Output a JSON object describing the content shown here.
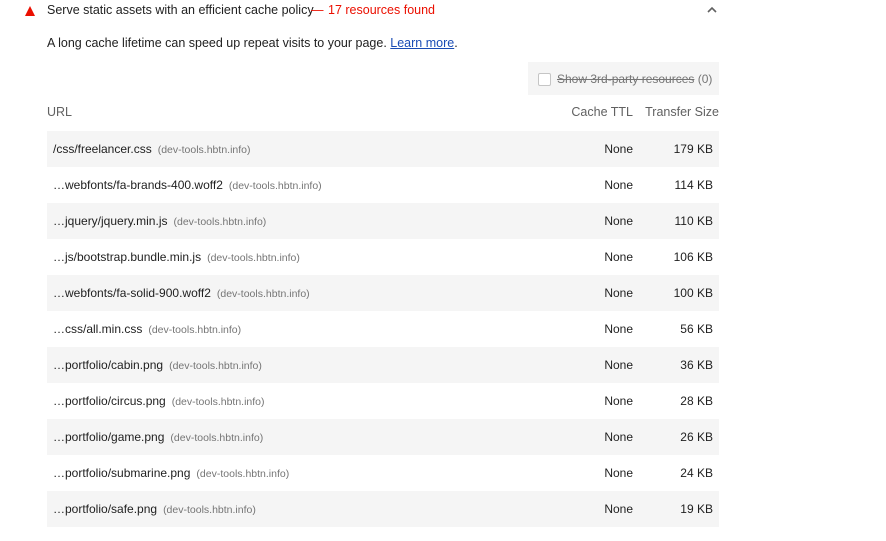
{
  "audit": {
    "title": "Serve static assets with an efficient cache policy",
    "separator": "—",
    "display_value": "17 resources found",
    "status_color": "#eb0f00",
    "icon": "fail-triangle-icon",
    "expand_icon": "chevron-up-icon"
  },
  "description": {
    "text": "A long cache lifetime can speed up repeat visits to your page.",
    "link_text": "Learn more",
    "link_suffix": "."
  },
  "third_party_filter": {
    "label": "Show 3rd-party resources",
    "count": "(0)",
    "checked": false
  },
  "table": {
    "headers": {
      "url": "URL",
      "cache_ttl": "Cache TTL",
      "transfer_size": "Transfer Size"
    },
    "rows": [
      {
        "url": "/css/freelancer.css",
        "host": "(dev-tools.hbtn.info)",
        "ttl": "None",
        "size": "179 KB"
      },
      {
        "url": "…webfonts/fa-brands-400.woff2",
        "host": "(dev-tools.hbtn.info)",
        "ttl": "None",
        "size": "114 KB"
      },
      {
        "url": "…jquery/jquery.min.js",
        "host": "(dev-tools.hbtn.info)",
        "ttl": "None",
        "size": "110 KB"
      },
      {
        "url": "…js/bootstrap.bundle.min.js",
        "host": "(dev-tools.hbtn.info)",
        "ttl": "None",
        "size": "106 KB"
      },
      {
        "url": "…webfonts/fa-solid-900.woff2",
        "host": "(dev-tools.hbtn.info)",
        "ttl": "None",
        "size": "100 KB"
      },
      {
        "url": "…css/all.min.css",
        "host": "(dev-tools.hbtn.info)",
        "ttl": "None",
        "size": "56 KB"
      },
      {
        "url": "…portfolio/cabin.png",
        "host": "(dev-tools.hbtn.info)",
        "ttl": "None",
        "size": "36 KB"
      },
      {
        "url": "…portfolio/circus.png",
        "host": "(dev-tools.hbtn.info)",
        "ttl": "None",
        "size": "28 KB"
      },
      {
        "url": "…portfolio/game.png",
        "host": "(dev-tools.hbtn.info)",
        "ttl": "None",
        "size": "26 KB"
      },
      {
        "url": "…portfolio/submarine.png",
        "host": "(dev-tools.hbtn.info)",
        "ttl": "None",
        "size": "24 KB"
      },
      {
        "url": "…portfolio/safe.png",
        "host": "(dev-tools.hbtn.info)",
        "ttl": "None",
        "size": "19 KB"
      }
    ]
  }
}
